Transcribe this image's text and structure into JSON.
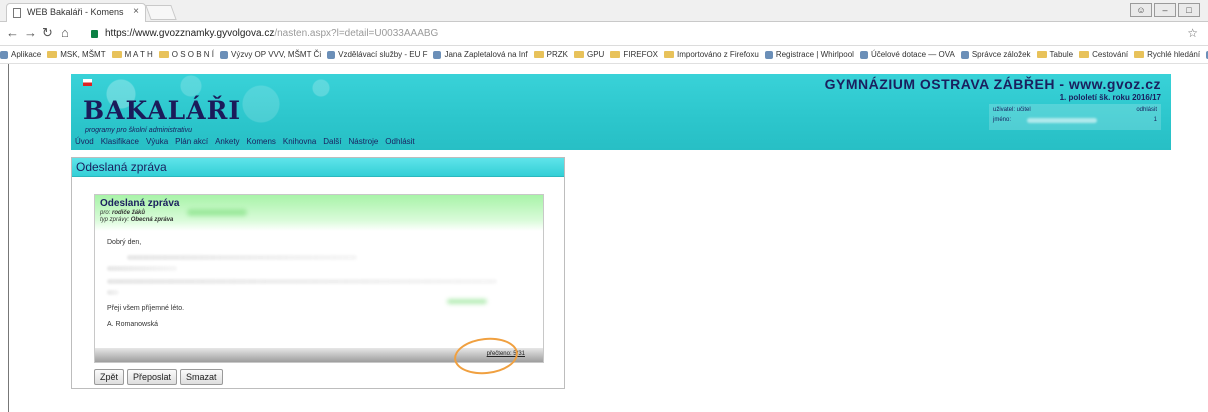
{
  "browser": {
    "tab_title": "WEB Bakaláři - Komens",
    "tab_close": "×",
    "url_main": "https://www.gvozznamky.gyvolgova.cz",
    "url_rest": "/nasten.aspx?l=detail=U0033AAABG",
    "bookmarks": [
      {
        "label": "Aplikace",
        "icon": "apps-icon"
      },
      {
        "label": "MSK, MŠMT",
        "icon": "folder-icon"
      },
      {
        "label": "M A T H",
        "icon": "folder-icon"
      },
      {
        "label": "O S O B N Í",
        "icon": "folder-icon"
      },
      {
        "label": "Výzvy OP VVV, MŠMT Či",
        "icon": "page-icon"
      },
      {
        "label": "Vzdělávací služby - EU F",
        "icon": "page-icon"
      },
      {
        "label": "Jana Zapletalová na Inf",
        "icon": "page-icon"
      },
      {
        "label": "PRZK",
        "icon": "folder-icon"
      },
      {
        "label": "GPU",
        "icon": "folder-icon"
      },
      {
        "label": "FIREFOX",
        "icon": "folder-icon"
      },
      {
        "label": "Importováno z Firefoxu",
        "icon": "folder-icon"
      },
      {
        "label": "Registrace | Whirlpool",
        "icon": "page-icon"
      },
      {
        "label": "Účelové dotace — OVA",
        "icon": "page-icon"
      },
      {
        "label": "Správce záložek",
        "icon": "star-icon"
      },
      {
        "label": "Tabule",
        "icon": "folder-icon"
      },
      {
        "label": "Cestování",
        "icon": "folder-icon"
      },
      {
        "label": "Rychlé hledání",
        "icon": "folder-icon"
      },
      {
        "label": "»",
        "icon": "more-icon"
      },
      {
        "label": "Ostatní záložky",
        "icon": "folder-icon"
      }
    ]
  },
  "site": {
    "logo": "BAKALÁŘI",
    "logo_sub": "programy pro školní administrativu",
    "school": "GYMNÁZIUM OSTRAVA ZÁBŘEH - www.gvoz.cz",
    "term": "1. pololetí šk. roku 2016/17",
    "user_label": "uživatel: učitel",
    "name_label": "jméno:",
    "logout_label": "odhlásit",
    "count": "1",
    "menu": [
      "Úvod",
      "Klasifikace",
      "Výuka",
      "Plán akcí",
      "Ankety",
      "Komens",
      "Knihovna",
      "Další",
      "Nástroje",
      "Odhlásit"
    ]
  },
  "panel": {
    "title": "Odeslaná zpráva",
    "message": {
      "title": "Odeslaná zpráva",
      "to_prefix": "pro:",
      "to": "rodiče žáků",
      "type_prefix": "typ zprávy:",
      "type": "Obecná zpráva",
      "greeting": "Dobrý den,",
      "wish": "Přeji všem příjemné léto.",
      "signature": "A. Romanowská",
      "read_status": "přečteno: 5/31"
    },
    "buttons": {
      "back": "Zpět",
      "forward": "Přeposlat",
      "delete": "Smazat"
    }
  },
  "colors": {
    "header_cyan": "#2cc6cc",
    "nav_text": "#1a1f5e",
    "highlight_circle": "#f0a040",
    "message_header_green": "#a8f3a8"
  }
}
